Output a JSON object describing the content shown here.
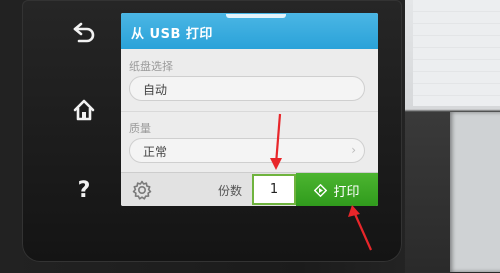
{
  "device": {
    "side_buttons": [
      {
        "name": "back",
        "icon": "back-arrow-icon"
      },
      {
        "name": "home",
        "icon": "home-icon"
      },
      {
        "name": "help",
        "icon": "help-icon",
        "glyph": "?"
      }
    ]
  },
  "screen": {
    "title": "从 USB 打印",
    "tray": {
      "label": "纸盘选择",
      "value": "自动"
    },
    "quality": {
      "label": "质量",
      "value": "正常",
      "chevron": "›"
    },
    "bottom": {
      "settings_icon": "gear-icon",
      "copies_label": "份数",
      "copies_value": "1",
      "print_label": "打印",
      "print_icon": "diamond-start-icon"
    }
  },
  "colors": {
    "titlebar": "#2aa2d9",
    "print_button": "#3ba625",
    "copies_border": "#6fb33e",
    "annotation_arrow": "#e8262a"
  }
}
